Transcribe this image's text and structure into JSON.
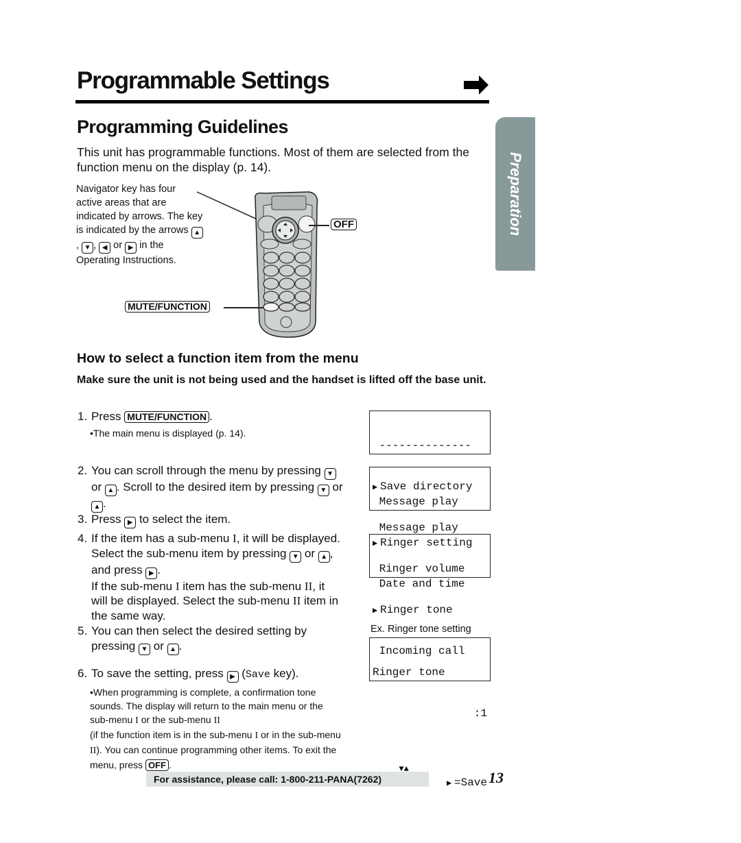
{
  "page": {
    "title": "Programmable Settings",
    "continue_icon": "right-arrow-icon",
    "section_heading": "Programming Guidelines",
    "intro": "This unit has programmable functions. Most of them are selected from the function menu on the display (p. 14).",
    "side_tab": "Preparation",
    "page_number": "13",
    "footer": "For assistance, please call: 1-800-211-PANA(7262)"
  },
  "diagram": {
    "nav_note_1": "Navigator key has four active areas that are indicated by arrows. The key is indicated by the arrows",
    "nav_note_comma1": ",",
    "nav_note_comma2": ",",
    "nav_note_or": "or",
    "nav_note_2": "in the Operating Instructions.",
    "mute_function_label": "MUTE/FUNCTION",
    "off_label": "OFF",
    "keys": {
      "up": "▲",
      "down": "▼",
      "left": "◀",
      "right": "▶"
    }
  },
  "howto": {
    "heading": "How to select a function item from the menu",
    "note": "Make sure the unit is not being used and the handset is lifted off the base unit.",
    "steps": [
      {
        "num": "1.",
        "a": "Press",
        "key": "MUTE/FUNCTION",
        "b": ".",
        "sub": "•The main menu is displayed (p. 14)."
      },
      {
        "num": "2.",
        "a": "You can scroll through the menu by pressing",
        "or1": "or",
        "b": ". Scroll to the desired item by pressing",
        "or2": "or",
        "c": "."
      },
      {
        "num": "3.",
        "a": "Press",
        "b": "to select the item."
      },
      {
        "num": "4.",
        "a": "If the item has a sub-menu",
        "m1": "I",
        "b": ", it will be displayed. Select the sub-menu item by pressing",
        "or1": "or",
        "c": ", and press",
        "d": ".",
        "e": "If the sub-menu",
        "m2": "I",
        "f": "item has the sub-menu",
        "m3": "II",
        "g": ", it will be displayed. Select the sub-menu",
        "m4": "II",
        "h": "item in the same way."
      },
      {
        "num": "5.",
        "a": "You can then select the desired setting by pressing",
        "or1": "or",
        "b": "."
      },
      {
        "num": "6.",
        "a": "To save the setting, press",
        "save": "Save",
        "b": "key).",
        "paren": "(",
        "sub1": "•When programming is complete, a confirmation tone sounds. The display will return to the main menu or the sub-menu",
        "m1": "I",
        "sub2": "or the sub-menu",
        "m2": "II",
        "sub3": "(if the function item is in the sub-menu",
        "m3": "I",
        "sub4": "or in the sub-menu",
        "m4": "II",
        "sub5": "). You can continue programming other items. To exit the menu, press",
        "off": "OFF",
        "sub6": "."
      }
    ]
  },
  "displays": [
    {
      "lines": [
        " --------------",
        "Save directory",
        " Message play"
      ],
      "selected": 1
    },
    {
      "lines": [
        " Message play",
        "Ringer setting",
        " Date and time"
      ],
      "selected": 1
    },
    {
      "lines": [
        " Ringer volume",
        "Ringer tone",
        " Incoming call"
      ],
      "selected": 1
    }
  ],
  "example": {
    "caption": "Ex. Ringer tone setting",
    "line1": "Ringer tone",
    "line2": ":1",
    "nav_arrows": "▼▲",
    "save_hint": "=Save"
  }
}
